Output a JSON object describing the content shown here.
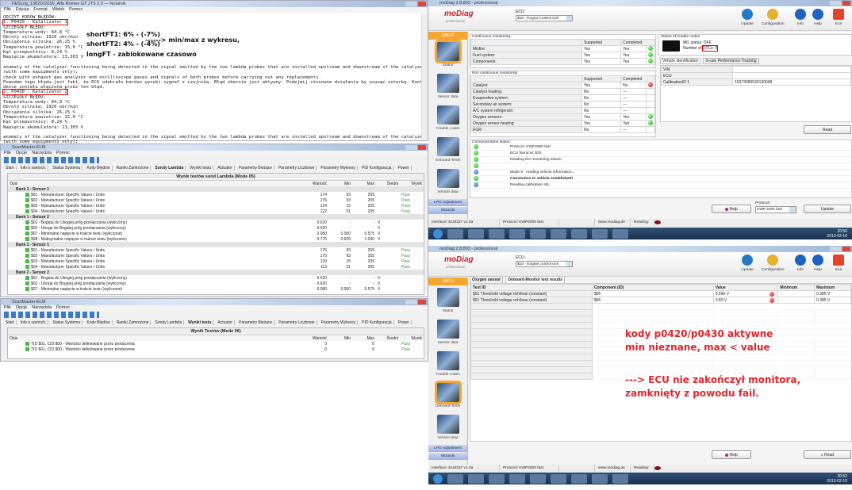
{
  "notepad": {
    "title": "FESLog_1302102036_Alfa Romeo GT JTS 2.0 — Notatnik",
    "menu": [
      "Plik",
      "Edycja",
      "Format",
      "Widok",
      "Pomoc"
    ],
    "text_pre": "ODCZYT KODÓW BŁĘDÓW:",
    "code1": "1: P0420 - Katalizator 1",
    "block1": "SZCZEGÓŁY BŁĘDU:\nTemperatura wody: 84,8 °C\nObroty silnika: 1920 obr/min\nObciążenie silnika: 26,25 %\nTemperatura powietrza: 15,0 °C\nKąt przepustnicy: 8,24 %\nNapięcie akumulatora: 13,303 V\n\nanomaly of the catalyzer functioning being detected in the signal emitted by the two lambda probes that are installed upstream and downstream of the catalyzer itself\n(with some equipments only);\ncheck with exhaust gas analyzer and oscilloscope gases and signals of both probes before carrying out any replacements.\nPowodem tego błędu jest fakt, że ECU odebrało bardzo wysoki sygnał z czujnika. Błąd obecnie jest aktywny. Podejmij stosowne działania by usunąć usterkę. Kontrolka na\ndesce została włączona przez ten błąd.",
    "code2": "2: P0430 - Katalizator 2",
    "block2": "SZCZEGÓŁY BŁĘDU:\nTemperatura wody: 84,8 °C\nObroty silnika: 1920 obr/min\nObciążenie silnika: 26,25 %\nTemperatura powietrza: 15,0 °C\nKąt przepustnicy: 8,24 %\nNapięcie akumulatora: 13,303 V\n\nanomaly of the catalyzer functioning being detected in the signal emitted by the two lambda probes that are installed upstream and downstream of the catalyzer itself\n(with some equipments only);\ncheck with exhaust gas analyzer and oscilloscope gases and signals of both probes before carrying out any replacements.\nPowodem tego błędu jest fakt, że ECU odebrało bardzo wysoki sygnał z czujnika. Błąd obecnie jest aktywny. Podejmij stosowne działania by usunąć usterkę. Kontrolka na\ndesce została włączona przez ten błąd.",
    "annotations": {
      "sft1": "shortFT1: 6% - (-7%)",
      "sft2": "shortFT2: 4% - (-4%)",
      "arrow": "------> min/max z wykresu,",
      "lft": "longFT - zablokowane czasowo"
    }
  },
  "scanmaster": {
    "title": "ScanMaster-ELM",
    "menu": [
      "Plik",
      "Opcje",
      "Narzędzia",
      "Pomoc"
    ],
    "tabs": [
      "Start",
      "Info o samoch.",
      "Status Systemu",
      "Kody Błędów",
      "Ramki Zamrożone",
      "Sondy Lambda",
      "Wyniki testu",
      "Actuator",
      "Parametry Bieżące",
      "Parametry Liczbowe",
      "Parametry Wykresy",
      "PID Konfiguracja",
      "Power"
    ],
    "columns": [
      "Opis",
      "Wartość",
      "Min",
      "Max",
      "Średni",
      "Wynik"
    ],
    "panel1": {
      "title": "Wynik testów sond Lambda (Mode 05)",
      "rows": [
        {
          "group": "Bank 1 - Sensor 1"
        },
        {
          "d": "$01 - Manufacturer Specific Values / Units",
          "v": "174",
          "min": "93",
          "max": "255",
          "avg": "",
          "res": "Pass"
        },
        {
          "d": "$02 - Manufacturer Specific Values / Units",
          "v": "176",
          "min": "93",
          "max": "255",
          "avg": "",
          "res": "Pass"
        },
        {
          "d": "$03 - Manufacturer Specific Values / Units",
          "v": "124",
          "min": "15",
          "max": "205",
          "avg": "",
          "res": "Pass"
        },
        {
          "d": "$04 - Manufacturer Specific Values / Units",
          "v": "122",
          "min": "51",
          "max": "205",
          "avg": "",
          "res": "Pass"
        },
        {
          "group": "Bank 1 - Sensor 2"
        },
        {
          "d": "$01 - Bogata do Ubogiej próg przełączania (wyliczony)",
          "v": "0.620",
          "min": "-",
          "max": "-",
          "avg": "V",
          "res": ""
        },
        {
          "d": "$02 - Uboga do Bogatej próg przełączania (wyliczony)",
          "v": "0.620",
          "min": "-",
          "max": "-",
          "avg": "V",
          "res": ""
        },
        {
          "d": "$07 - Minimalne napięcie w trakcie testu (wyliczone)",
          "v": "0.080",
          "min": "0.000",
          "max": "0.575",
          "avg": "V",
          "res": ""
        },
        {
          "d": "$08 - Maksymalne napięcie w trakcie testu (wyliczone)",
          "v": "0.775",
          "min": "0.625",
          "max": "1.030",
          "avg": "V",
          "res": ""
        },
        {
          "group": "Bank 2 - Sensor 1"
        },
        {
          "d": "$01 - Manufacturer Specific Values / Units",
          "v": "175",
          "min": "93",
          "max": "255",
          "avg": "",
          "res": "Pass"
        },
        {
          "d": "$02 - Manufacturer Specific Values / Units",
          "v": "175",
          "min": "93",
          "max": "255",
          "avg": "",
          "res": "Pass"
        },
        {
          "d": "$03 - Manufacturer Specific Values / Units",
          "v": "129",
          "min": "15",
          "max": "205",
          "avg": "",
          "res": "Pass"
        },
        {
          "d": "$04 - Manufacturer Specific Values / Units",
          "v": "113",
          "min": "51",
          "max": "205",
          "avg": "",
          "res": "Pass"
        },
        {
          "group": "Bank 2 - Sensor 2"
        },
        {
          "d": "$01 - Bogata do Ubogiej próg przełączania (wyliczony)",
          "v": "0.620",
          "min": "-",
          "max": "-",
          "avg": "V",
          "res": ""
        },
        {
          "d": "$02 - Uboga do Bogatej próg przełączania (wyliczony)",
          "v": "0.620",
          "min": "-",
          "max": "-",
          "avg": "V",
          "res": ""
        },
        {
          "d": "$07 - Minimalne napięcie w trakcie testu (wyliczone)",
          "v": "0.080",
          "min": "0.000",
          "max": "0.575",
          "avg": "V",
          "res": ""
        }
      ]
    },
    "panel2": {
      "title": "Wynik Testów (Mode 06)",
      "rows": [
        {
          "d": "TID $01, CID $00 - Wartości definiowane przez producenta",
          "v": "0",
          "min": "",
          "max": "0",
          "avg": "",
          "res": "Pass"
        },
        {
          "d": "TID $01, CID $00 - Wartości definiowane przez producenta",
          "v": "0",
          "min": "",
          "max": "0",
          "avg": "",
          "res": "Pass"
        }
      ]
    }
  },
  "modiag": {
    "title": "moDiag 2.8.803 - professional",
    "logo": "moDiag",
    "logo_sub": "professional",
    "ecu_label": "ECU:",
    "ecu_value": "$10 - Engine control unit",
    "header_buttons": [
      "Update",
      "Configuration",
      "Info",
      "Help",
      "Exit"
    ],
    "sidebar": {
      "header": "OBD II",
      "items": [
        "Status",
        "Sensor data",
        "Trouble codes",
        "Onboard-Tests",
        "Vehicle data"
      ],
      "bottom": [
        "LPG Adjustment",
        "Wizards"
      ]
    },
    "continuous": {
      "caption": "Continuous monitoring:",
      "cols": [
        "Supported",
        "Completed"
      ],
      "rows": [
        [
          "Misfire:",
          "Yes",
          "Yes",
          "ok"
        ],
        [
          "Fuel system:",
          "Yes",
          "Yes",
          "ok"
        ],
        [
          "Components:",
          "Yes",
          "Yes",
          "ok"
        ]
      ]
    },
    "noncontinuous": {
      "caption": "Non continuous monitoring",
      "cols": [
        "Supported",
        "Completed"
      ],
      "rows": [
        [
          "Catalyst:",
          "Yes",
          "No",
          "bad"
        ],
        [
          "Catalyst heating:",
          "No",
          "---",
          ""
        ],
        [
          "Evaporative system:",
          "No",
          "---",
          ""
        ],
        [
          "Secondary air system:",
          "No",
          "---",
          ""
        ],
        [
          "A/C system refrigerant:",
          "No",
          "---",
          ""
        ],
        [
          "Oxygen sensors:",
          "Yes",
          "Yes",
          "ok"
        ],
        [
          "Oxygen sensor heating:",
          "Yes",
          "Yes",
          "ok"
        ],
        [
          "EGR:",
          "No",
          "---",
          ""
        ]
      ]
    },
    "dtc": {
      "caption": "Status of trouble codes",
      "mil": "MIL status: OFF",
      "num_prefix": "Number of",
      "num_value": "DTCs: 0"
    },
    "vehicle_tabs": [
      "Vehicle identification",
      "In-use Performance Tracking"
    ],
    "vehicle_rows": [
      [
        "VIN",
        ""
      ],
      [
        "ECU",
        ""
      ],
      [
        "CalibrationID 1",
        "10373086530130008"
      ]
    ],
    "read": "Read",
    "comm": {
      "caption": "Communication status:",
      "rows": [
        [
          "ok",
          "Protocol: KWP2000 fast",
          false
        ],
        [
          "ok",
          "ECU found at: $10",
          false
        ],
        [
          "ok",
          "Reading the monitoring status...",
          false
        ],
        [
          "ok",
          "",
          false
        ],
        [
          "info",
          "Mode 9 - reading vehicle information...",
          false
        ],
        [
          "ok",
          "Connection to vehicle established!",
          true
        ],
        [
          "info",
          "Reading calibration Ids...",
          false
        ]
      ]
    },
    "help": "Help",
    "protocol_label": "Protocol:",
    "protocol_value": "KWP 2000 fast",
    "update_btn": "Update",
    "statusbar": [
      "Interface: ELM327 v1.3a",
      "Protocol: KWP2000 fast",
      "",
      "www.modiag.de",
      "Reading:"
    ],
    "clock1": [
      "20:56",
      "2013-02-10"
    ],
    "second": {
      "tabs": [
        "Oxygen sensor",
        "Onboard-Monitor test results"
      ],
      "cols": [
        "Test ID",
        "Component (ID)",
        "Value",
        "Minimum",
        "Maximum"
      ],
      "rows": [
        [
          "$01 Threshold voltage rich/lean (constant)",
          "$05",
          "0.595 V",
          "",
          "0.385 V"
        ],
        [
          "$01 Threshold voltage rich/lean (constant)",
          "$06",
          "0.83 V",
          "",
          "0.385 V"
        ]
      ],
      "annot1": "kody p0420/p0430 aktywne",
      "annot2": "min nieznane, max < value",
      "annot3": "---> ECU nie zakończył monitora,",
      "annot4": "zamknięty z powodu fail.",
      "help": "Help",
      "read": "Read",
      "clock": [
        "20:52",
        "2013-02-10"
      ]
    }
  },
  "colors": {
    "accent": "#f7a531",
    "annotation": "#e0262b",
    "pass": "#2a9d2a"
  }
}
